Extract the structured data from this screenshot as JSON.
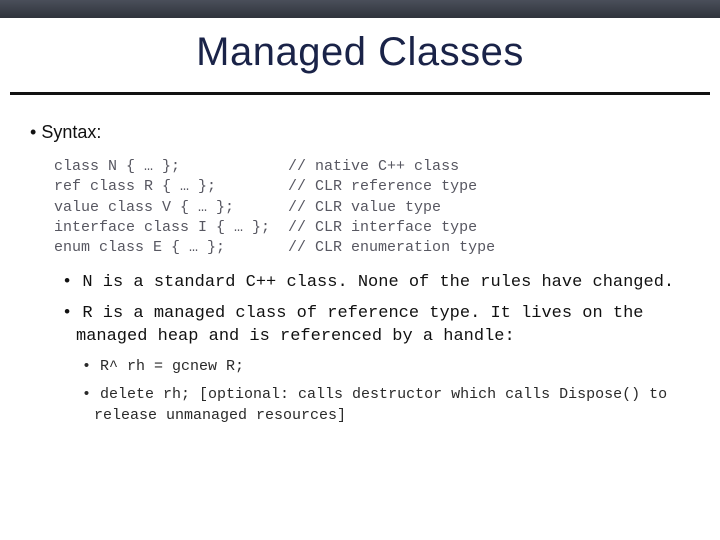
{
  "title": "Managed Classes",
  "syntax_label": "Syntax:",
  "code_block": "class N { … };            // native C++ class\nref class R { … };        // CLR reference type\nvalue class V { … };      // CLR value type\ninterface class I { … };  // CLR interface type\nenum class E { … };       // CLR enumeration type",
  "bullets_l2": [
    "N is a standard C++ class.  None of the rules have changed.",
    "R is a managed class of reference type.  It lives on the managed heap and is referenced by a handle:"
  ],
  "bullets_l3": [
    "R^ rh = gcnew R;",
    "delete rh;  [optional: calls destructor which calls Dispose() to release unmanaged resources]"
  ]
}
